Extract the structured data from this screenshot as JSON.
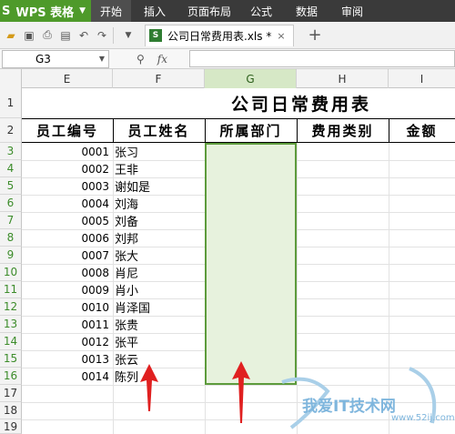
{
  "menubar": {
    "app_name": "WPS 表格",
    "items": [
      "开始",
      "插入",
      "页面布局",
      "公式",
      "数据",
      "审阅"
    ]
  },
  "toolbar": {
    "doc_tab_label": "公司日常费用表.xls *"
  },
  "formula_bar": {
    "cell_ref": "G3",
    "formula": ""
  },
  "columns": [
    "E",
    "F",
    "G",
    "H",
    "I"
  ],
  "selected_column": "G",
  "rows": [
    "1",
    "2",
    "3",
    "4",
    "5",
    "6",
    "7",
    "8",
    "9",
    "10",
    "11",
    "12",
    "13",
    "14",
    "15",
    "16",
    "17",
    "18",
    "19"
  ],
  "sheet": {
    "title": "公司日常费用表",
    "headers": [
      "员工编号",
      "员工姓名",
      "所属部门",
      "费用类别",
      "金额"
    ],
    "employees": [
      {
        "id": "0001",
        "name": "张习"
      },
      {
        "id": "0002",
        "name": "王非"
      },
      {
        "id": "0003",
        "name": "谢如是"
      },
      {
        "id": "0004",
        "name": "刘海"
      },
      {
        "id": "0005",
        "name": "刘备"
      },
      {
        "id": "0006",
        "name": "刘邦"
      },
      {
        "id": "0007",
        "name": "张大"
      },
      {
        "id": "0008",
        "name": "肖尼"
      },
      {
        "id": "0009",
        "name": "肖小"
      },
      {
        "id": "0010",
        "name": "肖泽国"
      },
      {
        "id": "0011",
        "name": "张贵"
      },
      {
        "id": "0012",
        "name": "张平"
      },
      {
        "id": "0013",
        "name": "张云"
      },
      {
        "id": "0014",
        "name": "陈列"
      }
    ]
  },
  "selection_range": "G3:G16",
  "watermark": {
    "text": "我爱IT技术网",
    "url": "www.52ij.com"
  },
  "colors": {
    "app_green": "#4e9a2a",
    "selection_fill": "#e7f2dd",
    "selection_border": "#5d9b3c",
    "arrow_red": "#e02020"
  }
}
